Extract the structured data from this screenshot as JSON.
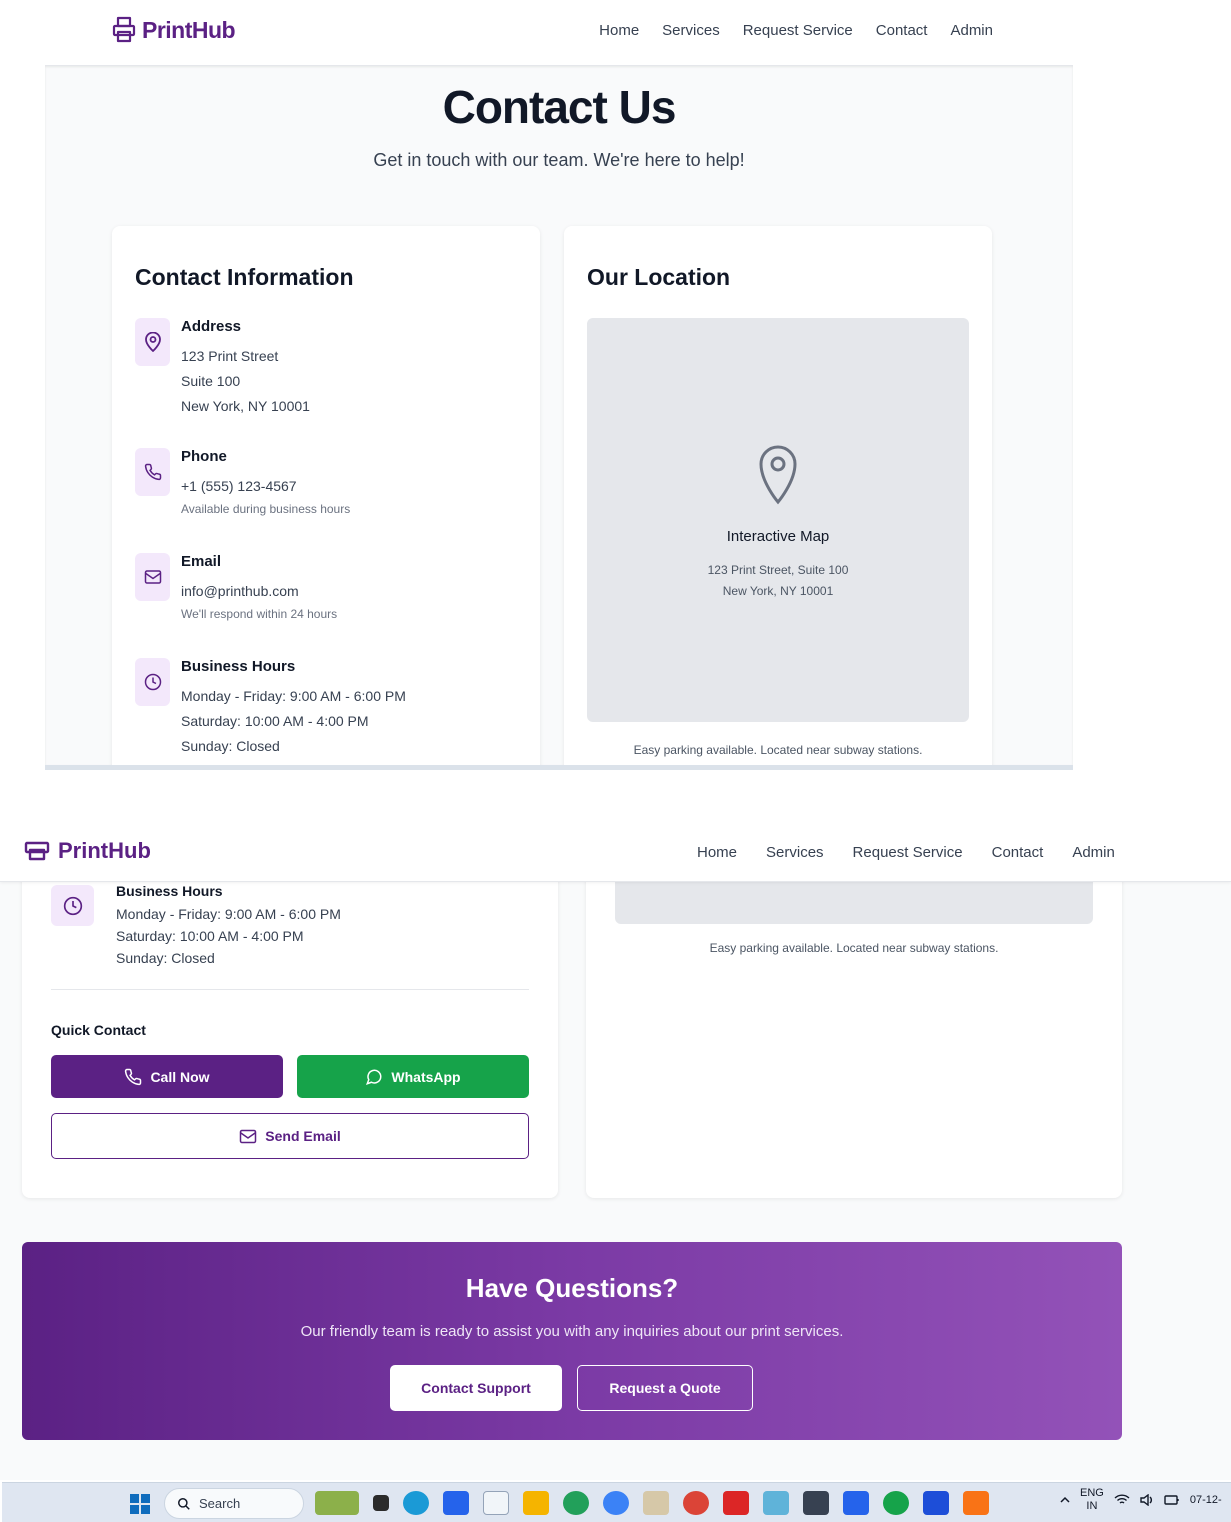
{
  "brand": "PrintHub",
  "nav": {
    "home": "Home",
    "services": "Services",
    "request": "Request Service",
    "contact": "Contact",
    "admin": "Admin"
  },
  "hero": {
    "title": "Contact Us",
    "subtitle": "Get in touch with our team. We're here to help!"
  },
  "contact_info": {
    "heading": "Contact Information",
    "address": {
      "label": "Address",
      "line1": "123 Print Street",
      "line2": "Suite 100",
      "line3": "New York, NY 10001"
    },
    "phone": {
      "label": "Phone",
      "value": "+1 (555) 123-4567",
      "note": "Available during business hours"
    },
    "email": {
      "label": "Email",
      "value": "info@printhub.com",
      "note": "We'll respond within 24 hours"
    },
    "hours": {
      "label": "Business Hours",
      "weekday": "Monday - Friday: 9:00 AM - 6:00 PM",
      "saturday": "Saturday: 10:00 AM - 4:00 PM",
      "sunday": "Sunday: Closed"
    }
  },
  "location": {
    "heading": "Our Location",
    "map_title": "Interactive Map",
    "map_line1": "123 Print Street, Suite 100",
    "map_line2": "New York, NY 10001",
    "parking": "Easy parking available. Located near subway stations."
  },
  "quick_contact": {
    "heading": "Quick Contact",
    "call": "Call Now",
    "whatsapp": "WhatsApp",
    "email": "Send Email"
  },
  "banner": {
    "title": "Have Questions?",
    "subtitle": "Our friendly team is ready to assist you with any inquiries about our print services.",
    "support": "Contact Support",
    "quote": "Request a Quote"
  },
  "taskbar": {
    "search": "Search",
    "lang1": "ENG",
    "lang2": "IN",
    "date": "07-12-"
  },
  "colors": {
    "brand": "#5b2184",
    "whatsapp": "#16a34a",
    "icon_bg": "#f3e8fb"
  }
}
